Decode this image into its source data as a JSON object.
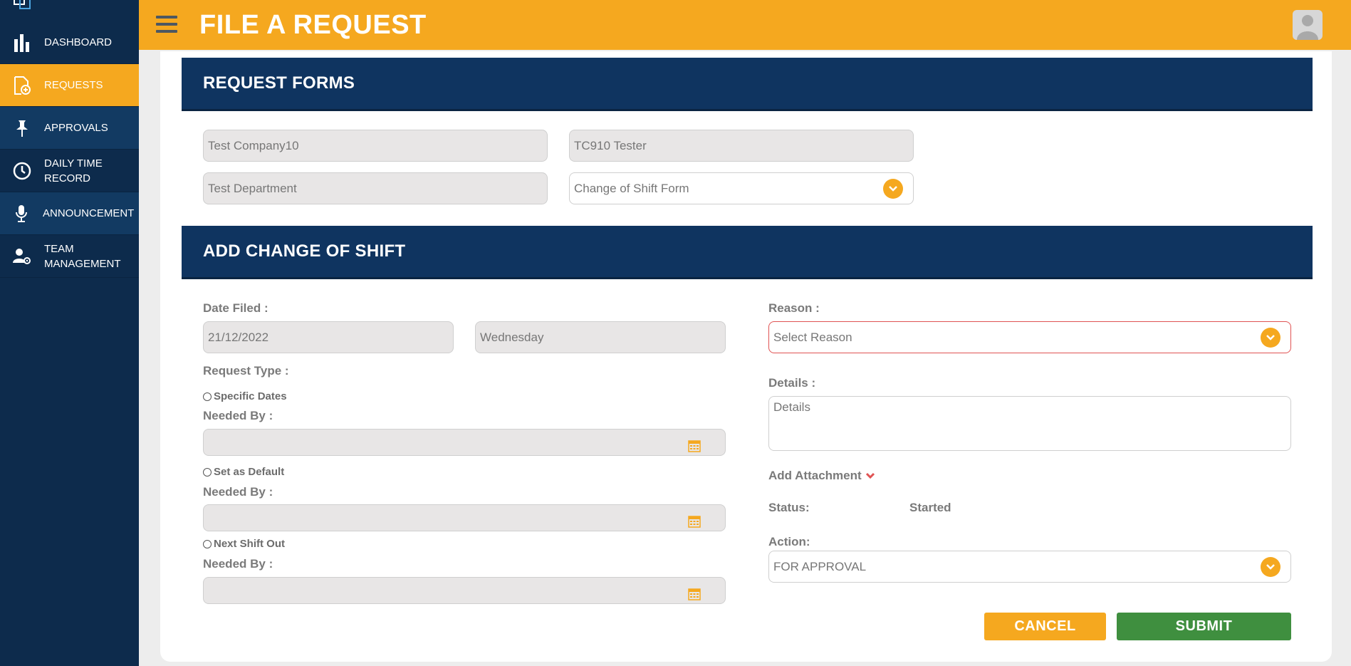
{
  "header": {
    "title": "FILE A REQUEST"
  },
  "sidebar": {
    "items": [
      {
        "label": "DASHBOARD",
        "icon": "bar-chart-icon"
      },
      {
        "label": "REQUESTS",
        "icon": "request-doc-icon"
      },
      {
        "label": "APPROVALS",
        "icon": "pushpin-icon"
      },
      {
        "label": "DAILY TIME RECORD",
        "icon": "clock-icon"
      },
      {
        "label": "ANNOUNCEMENT",
        "icon": "microphone-icon"
      },
      {
        "label": "TEAM MANAGEMENT",
        "icon": "user-gear-icon"
      }
    ],
    "active": "REQUESTS"
  },
  "request_forms": {
    "title": "REQUEST FORMS",
    "company": "Test Company10",
    "employee": "TC910 Tester",
    "department": "Test Department",
    "form_type": "Change of Shift Form"
  },
  "change_shift": {
    "title": "ADD CHANGE OF SHIFT",
    "date_filed_label": "Date Filed :",
    "date_filed": "21/12/2022",
    "day": "Wednesday",
    "request_type_label": "Request Type :",
    "options": [
      {
        "label": "Specific Dates",
        "needed_by_label": "Needed By :"
      },
      {
        "label": "Set as Default",
        "needed_by_label": "Needed By :"
      },
      {
        "label": "Next Shift Out",
        "needed_by_label": "Needed By :"
      }
    ],
    "reason_label": "Reason :",
    "reason_value": "Select Reason",
    "details_label": "Details :",
    "details_placeholder": "Details",
    "attachment_label": "Add Attachment",
    "status_label": "Status:",
    "status_value": "Started",
    "action_label": "Action:",
    "action_value": "FOR APPROVAL"
  },
  "buttons": {
    "cancel": "CANCEL",
    "submit": "SUBMIT"
  },
  "colors": {
    "accent": "#f5a81f",
    "navy": "#0f3460",
    "submit": "#3f8f3f",
    "error": "#e05353"
  }
}
